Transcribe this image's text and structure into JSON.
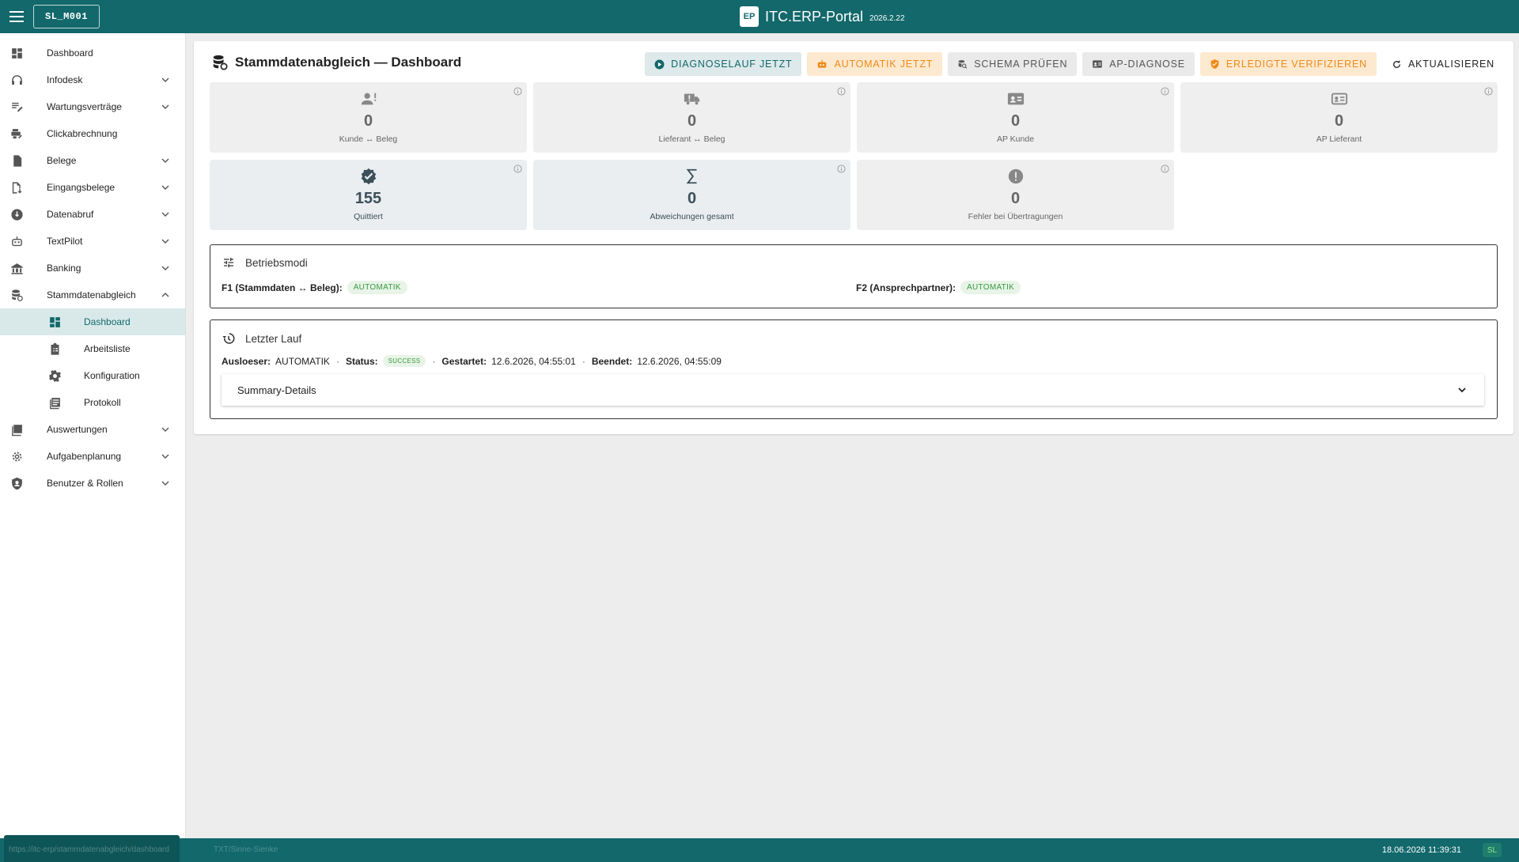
{
  "topbar": {
    "user_code": "SL_M001",
    "logo_text": "EP",
    "title": "ITC.ERP-Portal",
    "version": "2026.2.22"
  },
  "sidebar": {
    "items": [
      {
        "label": "Dashboard"
      },
      {
        "label": "Infodesk"
      },
      {
        "label": "Wartungsverträge"
      },
      {
        "label": "Clickabrechnung"
      },
      {
        "label": "Belege"
      },
      {
        "label": "Eingangsbelege"
      },
      {
        "label": "Datenabruf"
      },
      {
        "label": "TextPilot"
      },
      {
        "label": "Banking"
      },
      {
        "label": "Stammdatenabgleich"
      },
      {
        "label": "Dashboard"
      },
      {
        "label": "Arbeitsliste"
      },
      {
        "label": "Konfiguration"
      },
      {
        "label": "Protokoll"
      },
      {
        "label": "Auswertungen"
      },
      {
        "label": "Aufgabenplanung"
      },
      {
        "label": "Benutzer & Rollen"
      }
    ]
  },
  "main": {
    "title": "Stammdatenabgleich — Dashboard",
    "actions": {
      "diagnose": "DIAGNOSELAUF JETZT",
      "automatik": "AUTOMATIK JETZT",
      "schema": "SCHEMA PRÜFEN",
      "ap_diagnose": "AP-DIAGNOSE",
      "verify": "ERLEDIGTE VERIFIZIEREN",
      "refresh": "AKTUALISIEREN"
    },
    "stats": [
      {
        "value": "0",
        "label": "Kunde ↔ Beleg",
        "icon": "person-alert-icon"
      },
      {
        "value": "0",
        "label": "Lieferant ↔ Beleg",
        "icon": "truck-alert-icon"
      },
      {
        "value": "0",
        "label": "AP Kunde",
        "icon": "contact-card-icon"
      },
      {
        "value": "0",
        "label": "AP Lieferant",
        "icon": "contact-card-outline-icon"
      },
      {
        "value": "155",
        "label": "Quittiert",
        "icon": "verified-icon"
      },
      {
        "value": "0",
        "label": "Abweichungen gesamt",
        "icon": "sigma-icon"
      },
      {
        "value": "0",
        "label": "Fehler bei Übertragungen",
        "icon": "error-icon"
      }
    ],
    "modes": {
      "title": "Betriebsmodi",
      "f1_label": "F1 (Stammdaten ↔ Beleg):",
      "f1_value": "AUTOMATIK",
      "f2_label": "F2 (Ansprechpartner):",
      "f2_value": "AUTOMATIK"
    },
    "last_run": {
      "title": "Letzter Lauf",
      "trigger_label": "Ausloeser:",
      "trigger_value": "AUTOMATIK",
      "status_label": "Status:",
      "status_value": "SUCCESS",
      "started_label": "Gestartet:",
      "started_value": "12.6.2026, 04:55:01",
      "ended_label": "Beendet:",
      "ended_value": "12.6.2026, 04:55:09",
      "summary_label": "Summary-Details"
    }
  },
  "footer": {
    "url": "https://itc-erp/stammdatenabgleich/dashboard",
    "note": "TXT/Sinne-Sienke",
    "datetime": "18.06.2026 11:39:31",
    "badge": "SL"
  },
  "colors": {
    "brand": "#12686b",
    "accent_orange": "#ef8a1a",
    "success": "#3c9a43"
  }
}
